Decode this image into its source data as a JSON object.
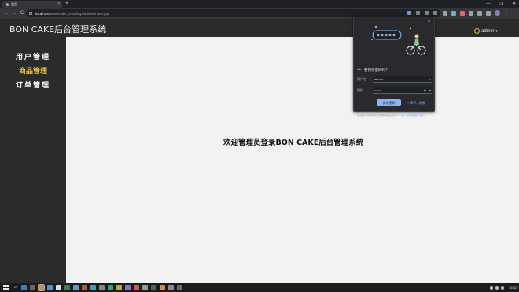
{
  "browser": {
    "tab_title": "首页",
    "tab_close": "×",
    "new_tab": "+",
    "window_controls": [
      "—",
      "❐",
      "✕"
    ],
    "nav": [
      "←",
      "→",
      "C"
    ],
    "url_host": "localhost",
    "url_path": ":8080/cake_shop/bqz/admin/index.jsp",
    "menu": "⋮"
  },
  "app": {
    "title": "BON CAKE后台管理系统",
    "user_label": "admin",
    "user_caret": "▾"
  },
  "sidebar": {
    "items": [
      {
        "label": "用户管理",
        "active": false
      },
      {
        "label": "商品管理",
        "active": true
      },
      {
        "label": "订单管理",
        "active": false
      }
    ]
  },
  "main": {
    "welcome": "欢迎管理员登录BON CAKE后台管理系统"
  },
  "password_popup": {
    "close": "✕",
    "key_icon": "⊶",
    "title": "要保存密码吗?",
    "username_label": "用户名",
    "username_value": "admin",
    "password_label": "密码",
    "password_value": "••••••",
    "eye_icon": "◉",
    "caret": "▾",
    "save_button": "保存密码",
    "never_button": "一律不，谢谢",
    "footer_text": "系统会将密码保存到您设备上的 ",
    "footer_link": "Google 密码管理工具",
    "footer_tail": "中。"
  },
  "taskbar": {
    "search_icon": "⌕",
    "clock": "16:32",
    "icon_colors": [
      "#3a7bd5",
      "#666666",
      "#d48c2a",
      "#4a90d9",
      "#e0e0e0",
      "#2d8a4e",
      "#5b9bd5",
      "#c94f3a",
      "#3c9ad6",
      "#888888",
      "#2aa876",
      "#c4a53b",
      "#8a6dc4",
      "#d9534f",
      "#999999",
      "#2e7d32",
      "#d88c3a",
      "#7d8ea8",
      "#6a6a6a"
    ]
  },
  "colors": {
    "sidebar_active": "#f1c232",
    "save_button": "#8ab4f8",
    "content_bg": "#f2f2f2",
    "header_bg": "#2b2b2b"
  }
}
